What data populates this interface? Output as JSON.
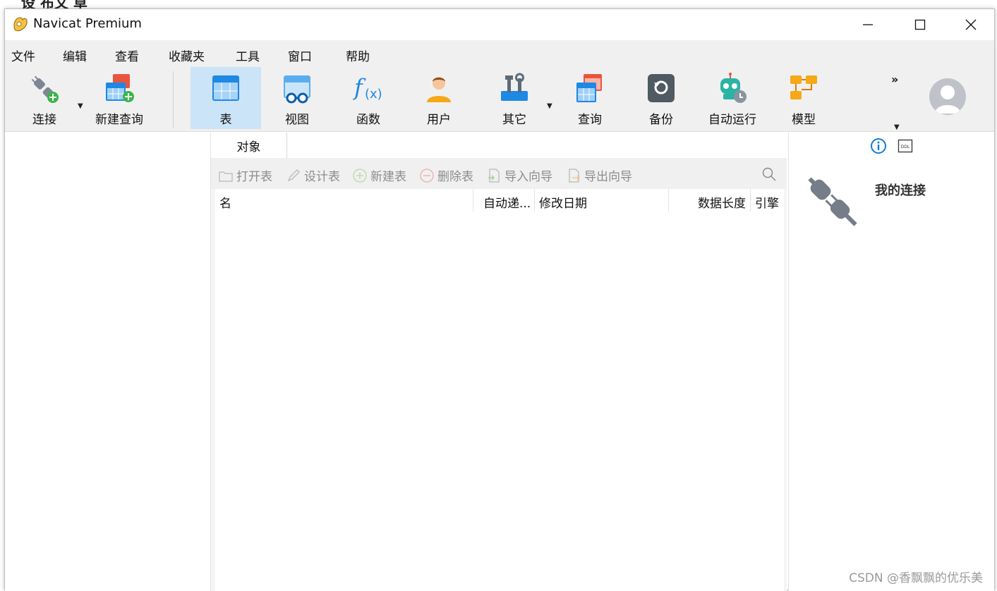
{
  "background": {
    "title": "设 布文 草"
  },
  "window": {
    "title": "Navicat Premium"
  },
  "menu": [
    "文件",
    "编辑",
    "查看",
    "收藏夹",
    "工具",
    "窗口",
    "帮助"
  ],
  "toolbar": {
    "connect": "连接",
    "new_query": "新建查询",
    "table": "表",
    "view": "视图",
    "function": "函数",
    "user": "用户",
    "other": "其它",
    "query": "查询",
    "backup": "备份",
    "automation": "自动运行",
    "model": "模型",
    "more": "»"
  },
  "tabs": {
    "objects": "对象"
  },
  "object_actions": {
    "open_table": "打开表",
    "design_table": "设计表",
    "new_table": "新建表",
    "delete_table": "删除表",
    "import_wizard": "导入向导",
    "export_wizard": "导出向导"
  },
  "columns": {
    "name": "名",
    "auto_increment": "自动递...",
    "modified": "修改日期",
    "data_length": "数据长度",
    "engine": "引擎"
  },
  "info_panel": {
    "connection_label": "我的连接"
  },
  "watermark": "CSDN @香飘飘的优乐美",
  "colors": {
    "accent": "#0f7bd8",
    "active_tool": "#cce4f7",
    "toolbar_bg": "#f0f0f0"
  }
}
